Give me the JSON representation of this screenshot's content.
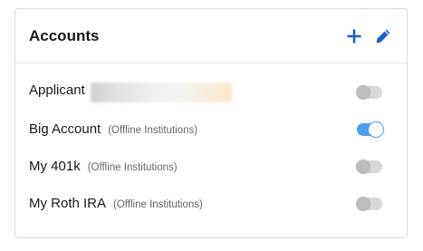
{
  "card": {
    "title": "Accounts",
    "icons": {
      "add": "plus-icon",
      "edit": "pencil-icon"
    },
    "accent_color": "#1f5fbf"
  },
  "accounts": [
    {
      "name": "Applicant",
      "subtitle": "",
      "enabled": false,
      "redacted_detail": true
    },
    {
      "name": "Big Account",
      "subtitle": "(Offline Institutions)",
      "enabled": true
    },
    {
      "name": "My 401k",
      "subtitle": "(Offline Institutions)",
      "enabled": false
    },
    {
      "name": "My Roth IRA",
      "subtitle": "(Offline Institutions)",
      "enabled": false
    }
  ],
  "colors": {
    "toggle_on": "#4a9df0",
    "toggle_off": "#d8d8d8"
  }
}
